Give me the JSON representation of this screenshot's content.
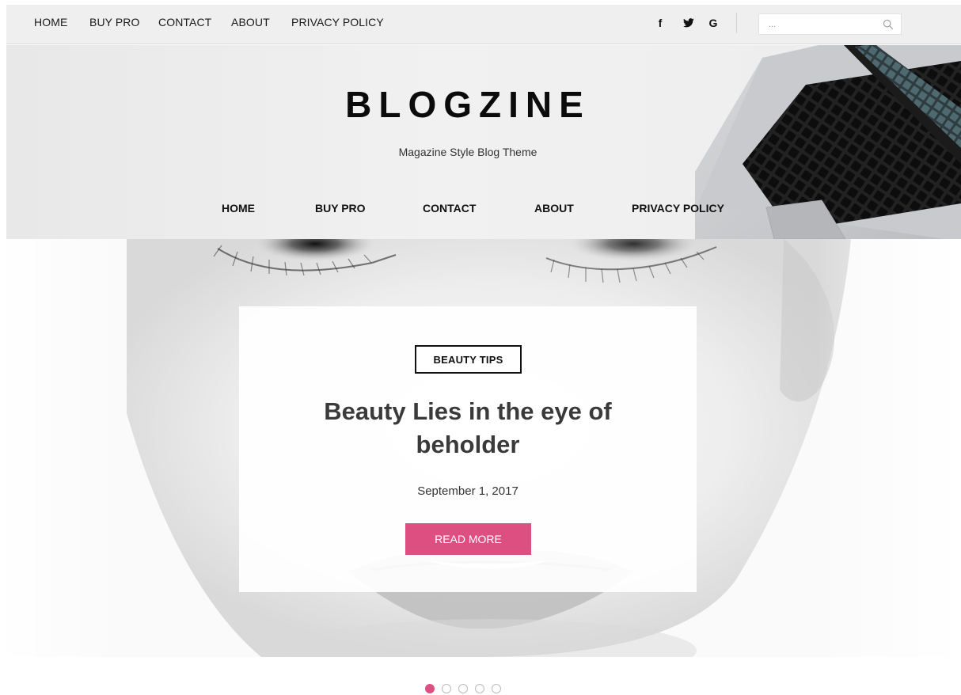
{
  "top_nav": {
    "items": [
      "HOME",
      "BUY PRO",
      "CONTACT",
      "ABOUT",
      "PRIVACY POLICY"
    ]
  },
  "social": {
    "facebook": "f",
    "twitter_icon": "twitter-bird-icon",
    "google": "G"
  },
  "search": {
    "placeholder": "...",
    "icon": "magnifier-icon"
  },
  "header": {
    "site_title": "BLOGZINE",
    "tagline": "Magazine Style Blog Theme"
  },
  "main_nav": {
    "items": [
      "HOME",
      "BUY PRO",
      "CONTACT",
      "ABOUT",
      "PRIVACY POLICY"
    ]
  },
  "slider": {
    "category": "BEAUTY TIPS",
    "title": "Beauty Lies in the eye of beholder",
    "date": "September 1, 2017",
    "button_label": "READ MORE",
    "slide_count": 5,
    "active_slide": 1
  },
  "colors": {
    "accent": "#dc4f80",
    "topbar_bg": "#efefef",
    "text_dark": "#111111"
  }
}
